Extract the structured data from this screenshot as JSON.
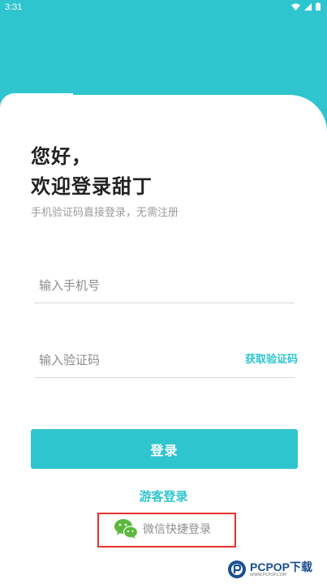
{
  "status_bar": {
    "time": "3:31"
  },
  "greeting": {
    "line1": "您好，",
    "line2": "欢迎登录甜丁"
  },
  "subtitle": "手机验证码直接登录，无需注册",
  "phone_field": {
    "placeholder": "输入手机号",
    "value": ""
  },
  "code_field": {
    "placeholder": "输入验证码",
    "value": ""
  },
  "get_code_label": "获取验证码",
  "login_button_label": "登录",
  "guest_login_label": "游客登录",
  "wechat_login_label": "微信快捷登录",
  "watermark": {
    "brand": "PCPOP下载",
    "sub": "WWW.PCPOP.COM"
  },
  "colors": {
    "accent": "#2fc5ce",
    "highlight_border": "#e4322b",
    "wechat_green": "#5ab93c"
  }
}
